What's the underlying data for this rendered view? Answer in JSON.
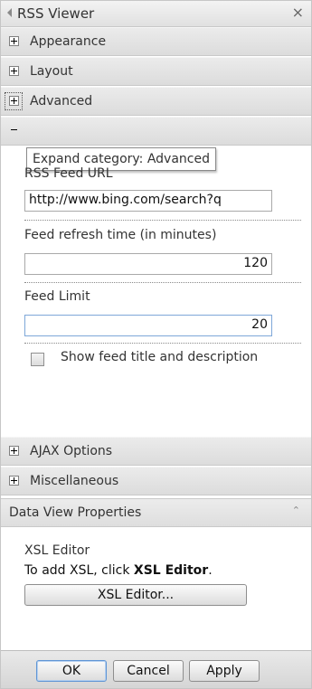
{
  "panel": {
    "title": "RSS Viewer",
    "close_glyph": "×"
  },
  "categories": [
    {
      "label": "Appearance"
    },
    {
      "label": "Layout"
    },
    {
      "label": "Advanced"
    }
  ],
  "tooltip": "Expand category: Advanced",
  "fields": {
    "rss_url_label": "RSS Feed URL",
    "rss_url_value": "http://www.bing.com/search?q",
    "refresh_label": "Feed refresh time (in minutes)",
    "refresh_value": "120",
    "limit_label": "Feed Limit",
    "limit_value": "20",
    "show_title_label": "Show feed title and description"
  },
  "more_categories": [
    {
      "label": "AJAX Options"
    },
    {
      "label": "Miscellaneous"
    }
  ],
  "data_view": {
    "header": "Data View Properties",
    "chevron_glyph": "⌃",
    "xsl_title": "XSL Editor",
    "xsl_hint_prefix": "To add XSL, click ",
    "xsl_hint_bold": "XSL Editor",
    "xsl_hint_suffix": ".",
    "xsl_button": "XSL Editor..."
  },
  "footer": {
    "ok": "OK",
    "cancel": "Cancel",
    "apply": "Apply"
  },
  "icons": {
    "collapse": "left-triangle-icon",
    "close": "close-icon",
    "expand": "plus-box-icon"
  }
}
